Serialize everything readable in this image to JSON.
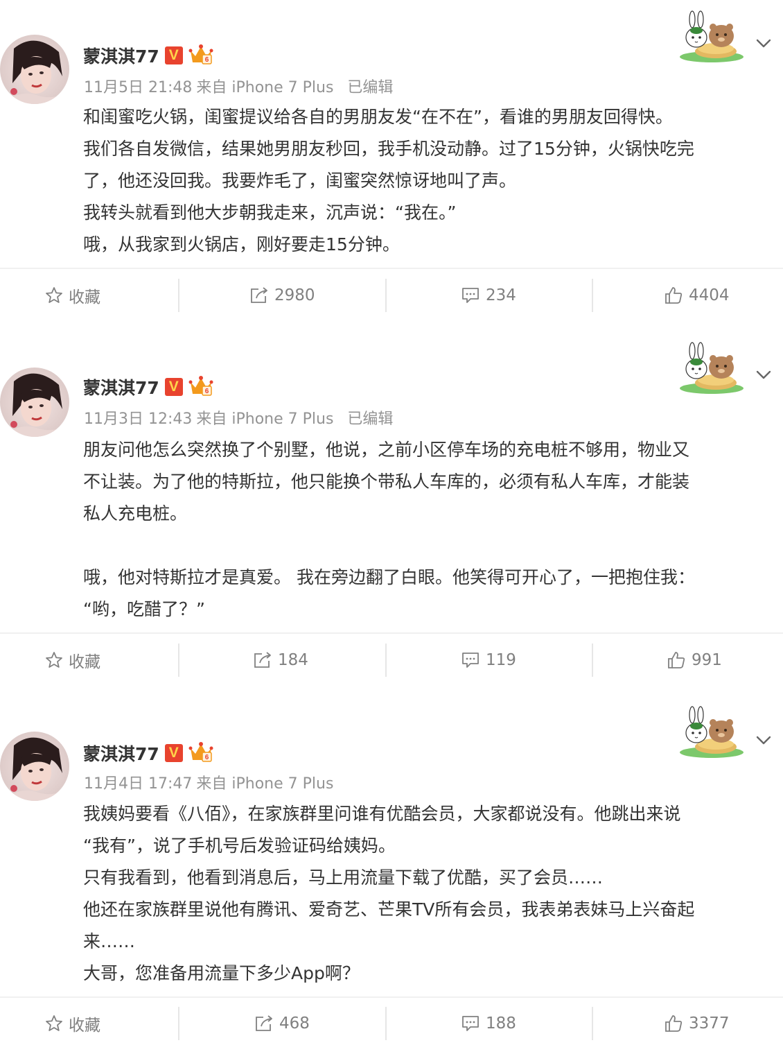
{
  "posts": [
    {
      "username": "蒙淇淇77",
      "badge_v": "V",
      "time": "11月5日 21:48",
      "source": "来自 iPhone 7 Plus",
      "edited": "已编辑",
      "content": [
        "和闺蜜吃火锅，闺蜜提议给各自的男朋友发“在不在”，看谁的男朋友回得快。",
        "我们各自发微信，结果她男朋友秒回，我手机没动静。过了15分钟，火锅快吃完",
        "了，他还没回我。我要炸毛了，闺蜜突然惊讶地叫了声。",
        "我转头就看到他大步朝我走来，沉声说：“我在。”",
        "哦，从我家到火锅店，刚好要走15分钟。"
      ],
      "actions": {
        "favorite": "收藏",
        "repost": "2980",
        "comment": "234",
        "like": "4404"
      }
    },
    {
      "username": "蒙淇淇77",
      "badge_v": "V",
      "time": "11月3日 12:43",
      "source": "来自 iPhone 7 Plus",
      "edited": "已编辑",
      "content": [
        "朋友问他怎么突然换了个别墅，他说，之前小区停车场的充电桩不够用，物业又",
        "不让装。为了他的特斯拉，他只能换个带私人车库的，必须有私人车库，才能装",
        "私人充电桩。",
        "",
        "哦，他对特斯拉才是真爱。 我在旁边翻了白眼。他笑得可开心了，一把抱住我：",
        "“哟，吃醋了？”"
      ],
      "actions": {
        "favorite": "收藏",
        "repost": "184",
        "comment": "119",
        "like": "991"
      }
    },
    {
      "username": "蒙淇淇77",
      "badge_v": "V",
      "time": "11月4日 17:47",
      "source": "来自 iPhone 7 Plus",
      "edited": "",
      "content": [
        "我姨妈要看《八佰》，在家族群里问谁有优酷会员，大家都说没有。他跳出来说",
        "“我有”，说了手机号后发验证码给姨妈。",
        "只有我看到，他看到消息后，马上用流量下载了优酷，买了会员……",
        "他还在家族群里说他有腾讯、爱奇艺、芒果TV所有会员，我表弟表妹马上兴奋起",
        "来……",
        "大哥，您准备用流量下多少App啊？"
      ],
      "actions": {
        "favorite": "收藏",
        "repost": "468",
        "comment": "188",
        "like": "3377"
      }
    }
  ],
  "icons": {
    "verified": "verified-v-badge",
    "crown": "crown-badge-icon",
    "sticker": "rabbit-bear-sticker",
    "menu": "chevron-down-icon",
    "favorite": "star-icon",
    "repost": "repost-icon",
    "comment": "comment-icon",
    "like": "thumbs-up-icon"
  },
  "colors": {
    "verified_badge": "#e8432e",
    "meta_text": "#939393",
    "action_text": "#808080"
  }
}
